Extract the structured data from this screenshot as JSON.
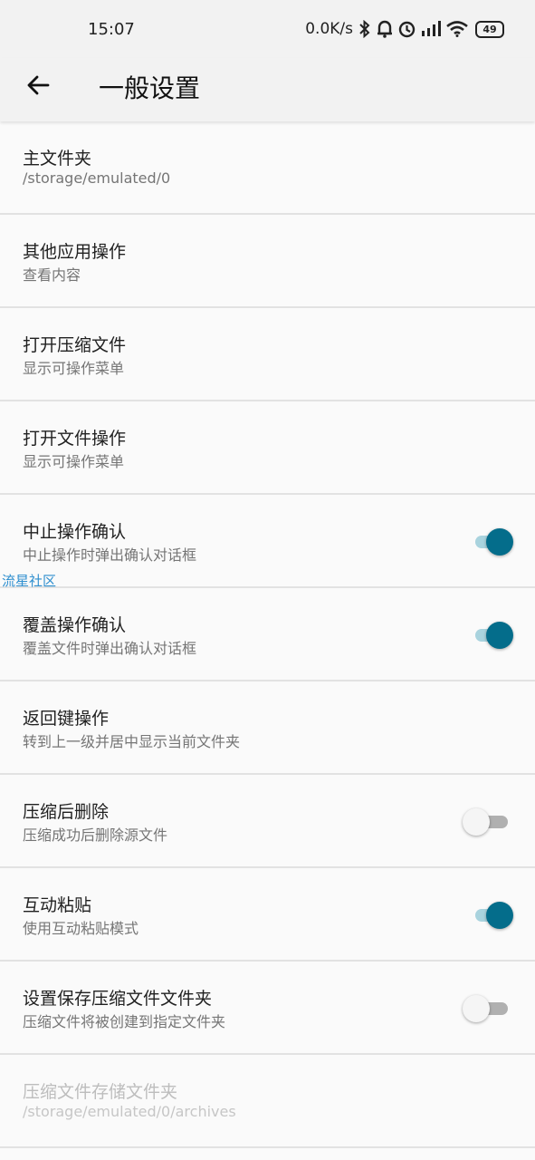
{
  "status_bar": {
    "time": "15:07",
    "network_speed": "0.0K/s",
    "battery": "49",
    "icons": [
      "bluetooth-icon",
      "bell-icon",
      "alarm-icon",
      "signal-icon",
      "wifi-icon",
      "battery-icon"
    ]
  },
  "app_bar": {
    "title": "一般设置",
    "back_icon": "arrow-left-icon"
  },
  "settings": [
    {
      "title": "主文件夹",
      "subtitle": "/storage/emulated/0"
    },
    {
      "title": "其他应用操作",
      "subtitle": "查看内容"
    },
    {
      "title": "打开压缩文件",
      "subtitle": "显示可操作菜单"
    },
    {
      "title": "打开文件操作",
      "subtitle": "显示可操作菜单"
    },
    {
      "title": "中止操作确认",
      "subtitle": "中止操作时弹出确认对话框",
      "toggle": true
    },
    {
      "title": "覆盖操作确认",
      "subtitle": "覆盖文件时弹出确认对话框",
      "toggle": true
    },
    {
      "title": "返回键操作",
      "subtitle": "转到上一级并居中显示当前文件夹"
    },
    {
      "title": "压缩后删除",
      "subtitle": "压缩成功后删除源文件",
      "toggle": false
    },
    {
      "title": "互动粘贴",
      "subtitle": "使用互动粘贴模式",
      "toggle": true
    },
    {
      "title": "设置保存压缩文件文件夹",
      "subtitle": "压缩文件将被创建到指定文件夹",
      "toggle": false
    },
    {
      "title": "压缩文件存储文件夹",
      "subtitle": "/storage/emulated/0/archives",
      "disabled": true
    }
  ],
  "watermark": "流星社区",
  "colors": {
    "accent": "#046d8b",
    "accent_track": "#a9d3de",
    "background": "#fafafa",
    "divider": "#e2e2e2"
  }
}
